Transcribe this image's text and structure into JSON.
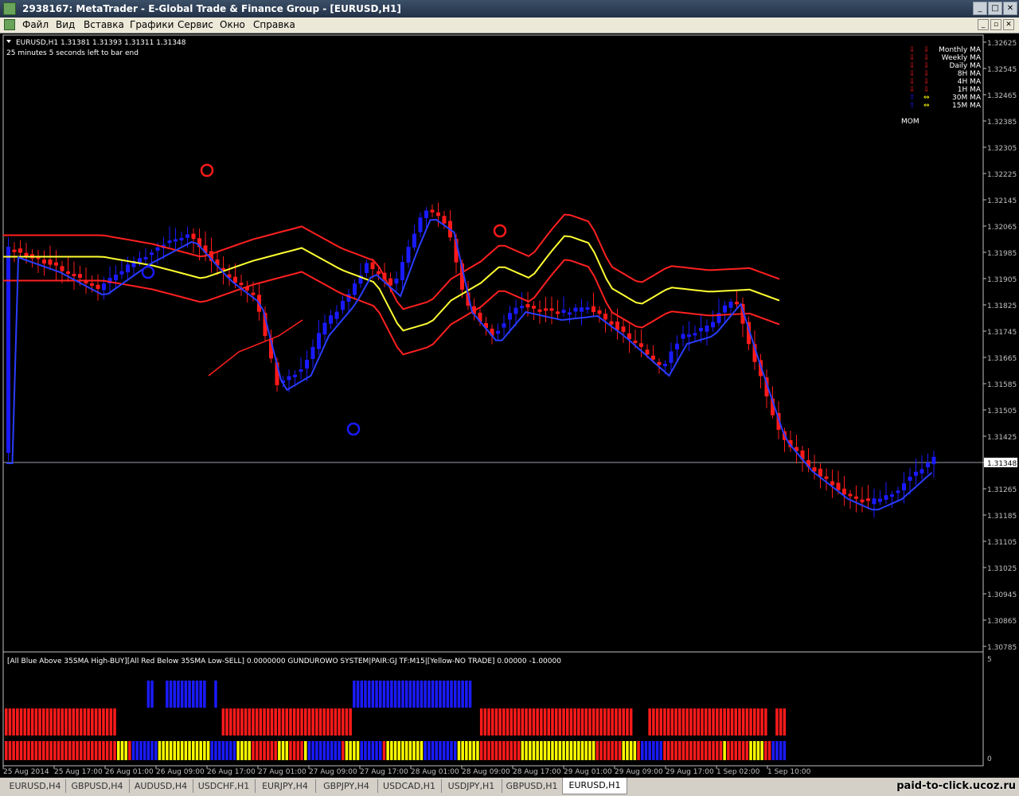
{
  "window": {
    "title": "2938167: MetaTrader - E-Global Trade & Finance Group - [EURUSD,H1]"
  },
  "menu": {
    "items": [
      "Файл",
      "Вид",
      "Вставка",
      "Графики",
      "Сервис",
      "Окно",
      "Справка"
    ]
  },
  "chart": {
    "header_line1": "EURUSD,H1  1.31381 1.31393 1.31311 1.31348",
    "header_line2": "25 minutes 5 seconds left to bar end",
    "current_price": "1.31348",
    "price_ticks": [
      "1.32625",
      "1.32545",
      "1.32465",
      "1.32385",
      "1.32305",
      "1.32225",
      "1.32145",
      "1.32065",
      "1.31985",
      "1.31905",
      "1.31825",
      "1.31745",
      "1.31665",
      "1.31585",
      "1.31505",
      "1.31425",
      "1.31348",
      "1.31265",
      "1.31185",
      "1.31105",
      "1.31025",
      "1.30945",
      "1.30865",
      "1.30785"
    ],
    "ma_legend": [
      {
        "label": "Monthly MA",
        "a": "down",
        "b": "down"
      },
      {
        "label": "Weekly MA",
        "a": "down",
        "b": "down"
      },
      {
        "label": "Daily MA",
        "a": "down",
        "b": "down"
      },
      {
        "label": "8H MA",
        "a": "down",
        "b": "down"
      },
      {
        "label": "4H MA",
        "a": "down",
        "b": "down"
      },
      {
        "label": "1H MA",
        "a": "down",
        "b": "down"
      },
      {
        "label": "30M MA",
        "a": "up",
        "b": "side"
      },
      {
        "label": "15M MA",
        "a": "up",
        "b": "side"
      }
    ],
    "mom_label": "MOM",
    "colors": {
      "bull": "#1a1aff",
      "bear": "#ff1a1a",
      "yellow_ma": "#ffff33",
      "red_band": "#ff2020",
      "blue_ma": "#2a3cff",
      "signal": "#ffff00"
    }
  },
  "indicator": {
    "label": "[All Blue Above 35SMA High-BUY][All Red Below 35SMA Low-SELL] 0.0000000  GUNDUROWO SYSTEM|PAIR:GJ TF:M15|[Yellow-NO TRADE] 0.00000 -1.00000",
    "scale_top": "5",
    "scale_bottom": "0"
  },
  "time_axis": [
    "25 Aug 2014",
    "25 Aug 17:00",
    "26 Aug 01:00",
    "26 Aug 09:00",
    "26 Aug 17:00",
    "27 Aug 01:00",
    "27 Aug 09:00",
    "27 Aug 17:00",
    "28 Aug 01:00",
    "28 Aug 09:00",
    "28 Aug 17:00",
    "29 Aug 01:00",
    "29 Aug 09:00",
    "29 Aug 17:00",
    "1 Sep 02:00",
    "1 Sep 10:00"
  ],
  "tabs": [
    "EURUSD,H4",
    "GBPUSD,H4",
    "AUDUSD,H4",
    "USDCHF,H1",
    "EURJPY,H4",
    "GBPJPY,H4",
    "USDCAD,H1",
    "USDJPY,H1",
    "GBPUSD,H1",
    "EURUSD,H1"
  ],
  "active_tab": "EURUSD,H1",
  "watermark": "paid-to-click.ucoz.ru"
}
